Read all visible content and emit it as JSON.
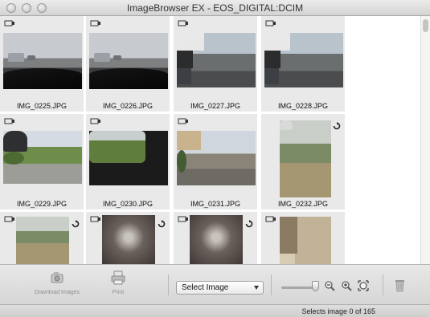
{
  "window": {
    "title": "ImageBrowser EX - EOS_DIGITAL:DCIM"
  },
  "images": [
    {
      "name": "IMG_0225.JPG",
      "scene": "dashcam-highway",
      "rotate": false
    },
    {
      "name": "IMG_0226.JPG",
      "scene": "dashcam-highway",
      "rotate": false
    },
    {
      "name": "IMG_0227.JPG",
      "scene": "street-traffic",
      "rotate": false
    },
    {
      "name": "IMG_0228.JPG",
      "scene": "street-traffic",
      "rotate": false
    },
    {
      "name": "IMG_0229.JPG",
      "scene": "yard-side-mirror",
      "rotate": false
    },
    {
      "name": "IMG_0230.JPG",
      "scene": "car-window-storefront",
      "rotate": false
    },
    {
      "name": "IMG_0231.JPG",
      "scene": "town-street",
      "rotate": false
    },
    {
      "name": "IMG_0232.JPG",
      "scene": "grass-lamp",
      "rotate": true
    },
    {
      "name": "",
      "scene": "grass-field",
      "rotate": true
    },
    {
      "name": "",
      "scene": "lamp-closeup",
      "rotate": true
    },
    {
      "name": "",
      "scene": "lamp-closeup",
      "rotate": true
    },
    {
      "name": "",
      "scene": "doorway",
      "rotate": false
    }
  ],
  "toolbar": {
    "download_label": "Download Images",
    "print_label": "Print",
    "select_value": "Select Image"
  },
  "status": {
    "text": "Selects image 0 of 165"
  }
}
